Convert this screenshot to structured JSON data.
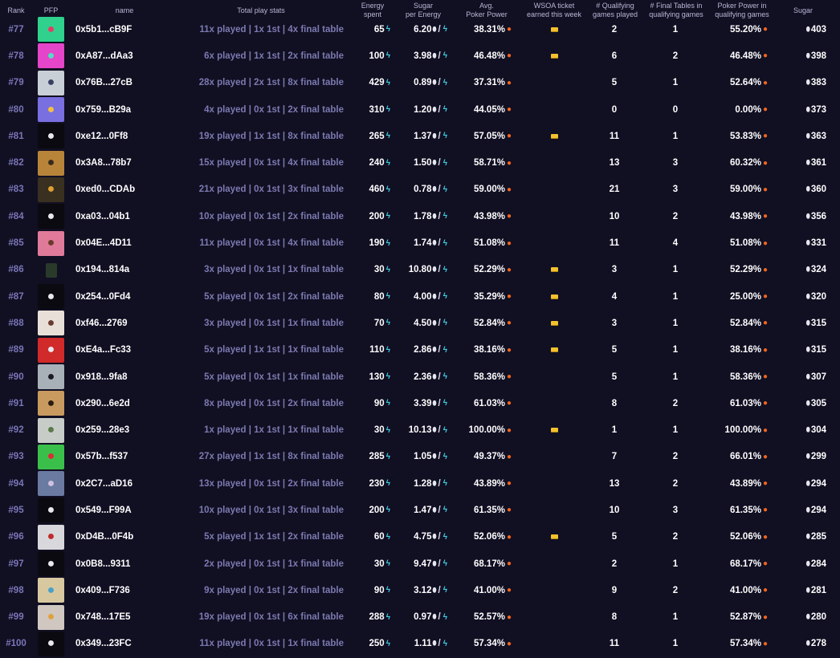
{
  "headers": {
    "rank": "Rank",
    "pfp": "PFP",
    "name": "name",
    "stats": "Total play stats",
    "energy": "Energy\nspent",
    "spe": "Sugar\nper Energy",
    "avg": "Avg.\nPoker Power",
    "ticket": "WSOA ticket\nearned this week",
    "qual": "# Qualifying\ngames played",
    "ft": "# Final Tables in\nqualifying games",
    "ppq": "Poker Power in\nqualifying games",
    "sugar": "Sugar"
  },
  "icons": {
    "energy": "lightning-bolt-icon",
    "sugar": "sugar-drop-icon",
    "power": "flame-icon",
    "ticket": "ticket-icon"
  },
  "colors": {
    "background": "#110f22",
    "rank": "#7a77b8",
    "stats": "#7b7ab0",
    "energy_icon": "#3fd2e8",
    "flame_icon": "#f0641e",
    "ticket_icon": "#f2c12e"
  },
  "rows": [
    {
      "rank": "#77",
      "name": "0x5b1...cB9F",
      "stats": "11x played | 1x 1st | 4x final table",
      "energy": "65",
      "spe": "6.20",
      "avg": "38.31%",
      "ticket": true,
      "qual": "2",
      "ft": "1",
      "ppq": "55.20%",
      "sugar": "403",
      "pfp": {
        "bg": "#2fd18c",
        "fg": "#e83a6a",
        "small": false
      }
    },
    {
      "rank": "#78",
      "name": "0xA87...dAa3",
      "stats": "6x played | 1x 1st | 2x final table",
      "energy": "100",
      "spe": "3.98",
      "avg": "46.48%",
      "ticket": true,
      "qual": "6",
      "ft": "2",
      "ppq": "46.48%",
      "sugar": "398",
      "pfp": {
        "bg": "#e545c8",
        "fg": "#4fe0c0",
        "small": false
      }
    },
    {
      "rank": "#79",
      "name": "0x76B...27cB",
      "stats": "28x played | 2x 1st | 8x final table",
      "energy": "429",
      "spe": "0.89",
      "avg": "37.31%",
      "ticket": false,
      "qual": "5",
      "ft": "1",
      "ppq": "52.64%",
      "sugar": "383",
      "pfp": {
        "bg": "#c9cfd6",
        "fg": "#3a3f64",
        "small": false
      }
    },
    {
      "rank": "#80",
      "name": "0x759...B29a",
      "stats": "4x played | 0x 1st | 2x final table",
      "energy": "310",
      "spe": "1.20",
      "avg": "44.05%",
      "ticket": false,
      "qual": "0",
      "ft": "0",
      "ppq": "0.00%",
      "sugar": "373",
      "pfp": {
        "bg": "#7a6fe0",
        "fg": "#f2c040",
        "small": false
      }
    },
    {
      "rank": "#81",
      "name": "0xe12...0Ff8",
      "stats": "19x played | 1x 1st | 8x final table",
      "energy": "265",
      "spe": "1.37",
      "avg": "57.05%",
      "ticket": true,
      "qual": "11",
      "ft": "1",
      "ppq": "53.83%",
      "sugar": "363",
      "pfp": {
        "bg": "#0a0a10",
        "fg": "#e8e8ee",
        "small": false
      }
    },
    {
      "rank": "#82",
      "name": "0x3A8...78b7",
      "stats": "15x played | 0x 1st | 4x final table",
      "energy": "240",
      "spe": "1.50",
      "avg": "58.71%",
      "ticket": false,
      "qual": "13",
      "ft": "3",
      "ppq": "60.32%",
      "sugar": "361",
      "pfp": {
        "bg": "#b8843a",
        "fg": "#3a2a1a",
        "small": false
      }
    },
    {
      "rank": "#83",
      "name": "0xed0...CDAb",
      "stats": "21x played | 0x 1st | 3x final table",
      "energy": "460",
      "spe": "0.78",
      "avg": "59.00%",
      "ticket": false,
      "qual": "21",
      "ft": "3",
      "ppq": "59.00%",
      "sugar": "360",
      "pfp": {
        "bg": "#3a3020",
        "fg": "#e0a030",
        "small": false
      }
    },
    {
      "rank": "#84",
      "name": "0xa03...04b1",
      "stats": "10x played | 0x 1st | 2x final table",
      "energy": "200",
      "spe": "1.78",
      "avg": "43.98%",
      "ticket": false,
      "qual": "10",
      "ft": "2",
      "ppq": "43.98%",
      "sugar": "356",
      "pfp": {
        "bg": "#0a0a10",
        "fg": "#e8e8ee",
        "small": false
      }
    },
    {
      "rank": "#85",
      "name": "0x04E...4D11",
      "stats": "11x played | 0x 1st | 4x final table",
      "energy": "190",
      "spe": "1.74",
      "avg": "51.08%",
      "ticket": false,
      "qual": "11",
      "ft": "4",
      "ppq": "51.08%",
      "sugar": "331",
      "pfp": {
        "bg": "#e07a9a",
        "fg": "#6a3a2a",
        "small": false
      }
    },
    {
      "rank": "#86",
      "name": "0x194...814a",
      "stats": "3x played | 0x 1st | 1x final table",
      "energy": "30",
      "spe": "10.80",
      "avg": "52.29%",
      "ticket": true,
      "qual": "3",
      "ft": "1",
      "ppq": "52.29%",
      "sugar": "324",
      "pfp": {
        "bg": "#2a3a2a",
        "fg": "#b0e040",
        "small": true
      }
    },
    {
      "rank": "#87",
      "name": "0x254...0Fd4",
      "stats": "5x played | 0x 1st | 2x final table",
      "energy": "80",
      "spe": "4.00",
      "avg": "35.29%",
      "ticket": true,
      "qual": "4",
      "ft": "1",
      "ppq": "25.00%",
      "sugar": "320",
      "pfp": {
        "bg": "#0a0a10",
        "fg": "#e8e8ee",
        "small": false
      }
    },
    {
      "rank": "#88",
      "name": "0xf46...2769",
      "stats": "3x played | 0x 1st | 1x final table",
      "energy": "70",
      "spe": "4.50",
      "avg": "52.84%",
      "ticket": true,
      "qual": "3",
      "ft": "1",
      "ppq": "52.84%",
      "sugar": "315",
      "pfp": {
        "bg": "#e8e0d8",
        "fg": "#6a3a30",
        "small": false
      }
    },
    {
      "rank": "#89",
      "name": "0xE4a...Fc33",
      "stats": "5x played | 1x 1st | 1x final table",
      "energy": "110",
      "spe": "2.86",
      "avg": "38.16%",
      "ticket": true,
      "qual": "5",
      "ft": "1",
      "ppq": "38.16%",
      "sugar": "315",
      "pfp": {
        "bg": "#d02a2a",
        "fg": "#e8e8ee",
        "small": false
      }
    },
    {
      "rank": "#90",
      "name": "0x918...9fa8",
      "stats": "5x played | 0x 1st | 1x final table",
      "energy": "130",
      "spe": "2.36",
      "avg": "58.36%",
      "ticket": false,
      "qual": "5",
      "ft": "1",
      "ppq": "58.36%",
      "sugar": "307",
      "pfp": {
        "bg": "#a8b0b8",
        "fg": "#1a1a22",
        "small": false
      }
    },
    {
      "rank": "#91",
      "name": "0x290...6e2d",
      "stats": "8x played | 0x 1st | 2x final table",
      "energy": "90",
      "spe": "3.39",
      "avg": "61.03%",
      "ticket": false,
      "qual": "8",
      "ft": "2",
      "ppq": "61.03%",
      "sugar": "305",
      "pfp": {
        "bg": "#c89a60",
        "fg": "#2a1a10",
        "small": false
      }
    },
    {
      "rank": "#92",
      "name": "0x259...28e3",
      "stats": "1x played | 1x 1st | 1x final table",
      "energy": "30",
      "spe": "10.13",
      "avg": "100.00%",
      "ticket": true,
      "qual": "1",
      "ft": "1",
      "ppq": "100.00%",
      "sugar": "304",
      "pfp": {
        "bg": "#c8ccc8",
        "fg": "#5a7a4a",
        "small": false
      }
    },
    {
      "rank": "#93",
      "name": "0x57b...f537",
      "stats": "27x played | 1x 1st | 8x final table",
      "energy": "285",
      "spe": "1.05",
      "avg": "49.37%",
      "ticket": false,
      "qual": "7",
      "ft": "2",
      "ppq": "66.01%",
      "sugar": "299",
      "pfp": {
        "bg": "#3ac04a",
        "fg": "#e02a3a",
        "small": false
      }
    },
    {
      "rank": "#94",
      "name": "0x2C7...aD16",
      "stats": "13x played | 0x 1st | 2x final table",
      "energy": "230",
      "spe": "1.28",
      "avg": "43.89%",
      "ticket": false,
      "qual": "13",
      "ft": "2",
      "ppq": "43.89%",
      "sugar": "294",
      "pfp": {
        "bg": "#6a7aa0",
        "fg": "#d0c0e0",
        "small": false
      }
    },
    {
      "rank": "#95",
      "name": "0x549...F99A",
      "stats": "10x played | 0x 1st | 3x final table",
      "energy": "200",
      "spe": "1.47",
      "avg": "61.35%",
      "ticket": false,
      "qual": "10",
      "ft": "3",
      "ppq": "61.35%",
      "sugar": "294",
      "pfp": {
        "bg": "#0a0a10",
        "fg": "#e8e8ee",
        "small": false
      }
    },
    {
      "rank": "#96",
      "name": "0xD4B...0F4b",
      "stats": "5x played | 1x 1st | 2x final table",
      "energy": "60",
      "spe": "4.75",
      "avg": "52.06%",
      "ticket": true,
      "qual": "5",
      "ft": "2",
      "ppq": "52.06%",
      "sugar": "285",
      "pfp": {
        "bg": "#d8d8dc",
        "fg": "#c02a2a",
        "small": false
      }
    },
    {
      "rank": "#97",
      "name": "0x0B8...9311",
      "stats": "2x played | 0x 1st | 1x final table",
      "energy": "30",
      "spe": "9.47",
      "avg": "68.17%",
      "ticket": false,
      "qual": "2",
      "ft": "1",
      "ppq": "68.17%",
      "sugar": "284",
      "pfp": {
        "bg": "#0a0a10",
        "fg": "#e8e8ee",
        "small": false
      }
    },
    {
      "rank": "#98",
      "name": "0x409...F736",
      "stats": "9x played | 0x 1st | 2x final table",
      "energy": "90",
      "spe": "3.12",
      "avg": "41.00%",
      "ticket": false,
      "qual": "9",
      "ft": "2",
      "ppq": "41.00%",
      "sugar": "281",
      "pfp": {
        "bg": "#d8c8a0",
        "fg": "#4aa0c8",
        "small": false
      }
    },
    {
      "rank": "#99",
      "name": "0x748...17E5",
      "stats": "19x played | 0x 1st | 6x final table",
      "energy": "288",
      "spe": "0.97",
      "avg": "52.57%",
      "ticket": false,
      "qual": "8",
      "ft": "1",
      "ppq": "52.87%",
      "sugar": "280",
      "pfp": {
        "bg": "#d0c8c0",
        "fg": "#e0a040",
        "small": false
      }
    },
    {
      "rank": "#100",
      "name": "0x349...23FC",
      "stats": "11x played | 0x 1st | 1x final table",
      "energy": "250",
      "spe": "1.11",
      "avg": "57.34%",
      "ticket": false,
      "qual": "11",
      "ft": "1",
      "ppq": "57.34%",
      "sugar": "278",
      "pfp": {
        "bg": "#0a0a10",
        "fg": "#e8e8ee",
        "small": false
      }
    }
  ]
}
